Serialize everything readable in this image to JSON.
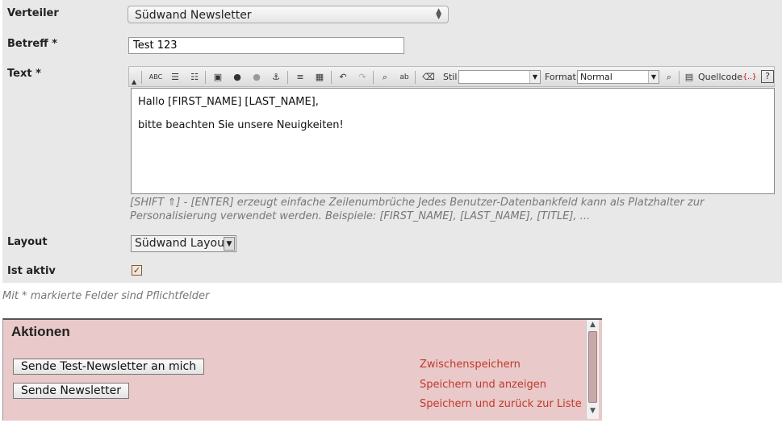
{
  "form": {
    "verteiler": {
      "label": "Verteiler",
      "value": "Südwand Newsletter"
    },
    "betreff": {
      "label": "Betreff *",
      "value": "Test 123"
    },
    "text": {
      "label": "Text *",
      "toolbar": {
        "stil_label": "Stil",
        "stil_value": "",
        "format_label": "Format",
        "format_value": "Normal",
        "source_label": "Quellcode"
      },
      "content": [
        "Hallo [FIRST_NAME] [LAST_NAME],",
        "bitte beachten Sie unsere Neuigkeiten!"
      ],
      "hint": "[SHIFT ⇑] - [ENTER] erzeugt einfache Zeilenumbrüche Jedes Benutzer-Datenbankfeld kann als Platzhalter zur Personalisierung verwendet werden. Beispiele: [FIRST_NAME], [LAST_NAME], [TITLE], ..."
    },
    "layout": {
      "label": "Layout",
      "value": "Südwand Layout"
    },
    "active": {
      "label": "Ist aktiv",
      "checked": true
    }
  },
  "required_note": "Mit * markierte Felder sind Pflichtfelder",
  "actions": {
    "title": "Aktionen",
    "buttons": [
      "Sende Test-Newsletter an mich",
      "Sende Newsletter"
    ],
    "links": [
      "Zwischenspeichern",
      "Speichern und anzeigen",
      "Speichern und zurück zur Liste"
    ]
  },
  "colors": {
    "link": "#c0392b",
    "actions_bg": "#e9c9c9",
    "form_bg": "#e8e8e8"
  }
}
